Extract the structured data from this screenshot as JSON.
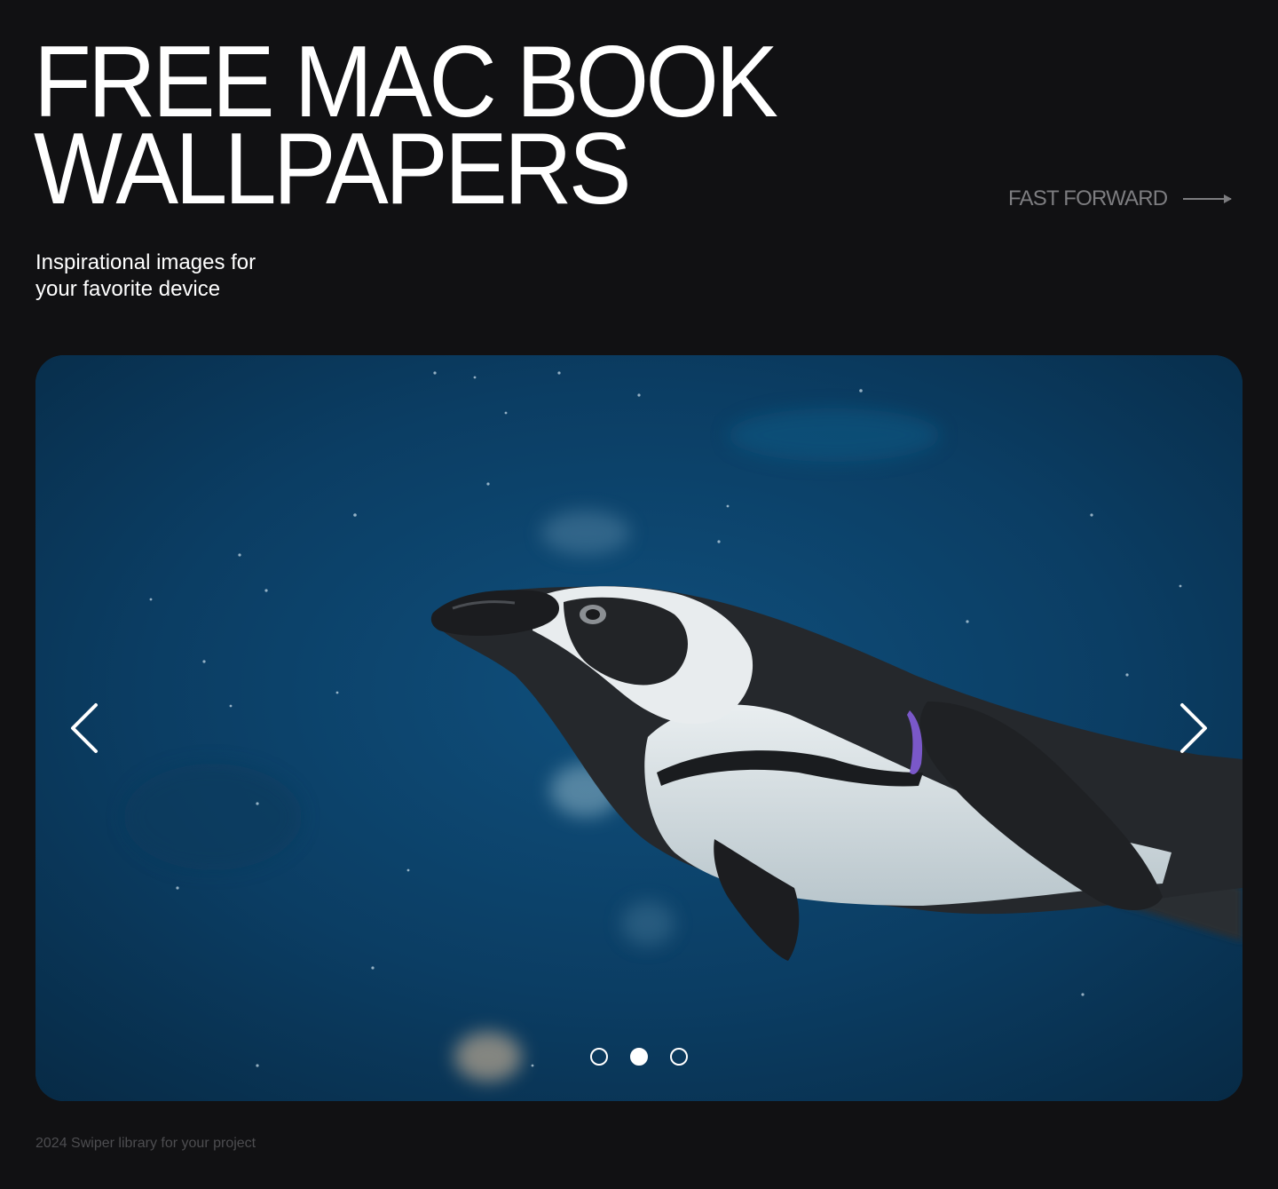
{
  "header": {
    "title_line1": "FREE MAC BOOK",
    "title_line2": "WALLPAPERS",
    "subtitle_line1": "Inspirational images for",
    "subtitle_line2": "your favorite device",
    "fast_forward_label": "FAST FORWARD",
    "fast_forward_icon": "long-arrow-right-icon"
  },
  "slider": {
    "prev_icon": "chevron-left-icon",
    "next_icon": "chevron-right-icon",
    "active_index": 1,
    "slide_count": 3
  },
  "footer": {
    "note": "2024 Swiper library for your project"
  },
  "colors": {
    "background": "#111113",
    "title": "#ffffff",
    "muted": "#7d7d80",
    "footer": "#4d4d50",
    "water": "#0c3a5c"
  }
}
